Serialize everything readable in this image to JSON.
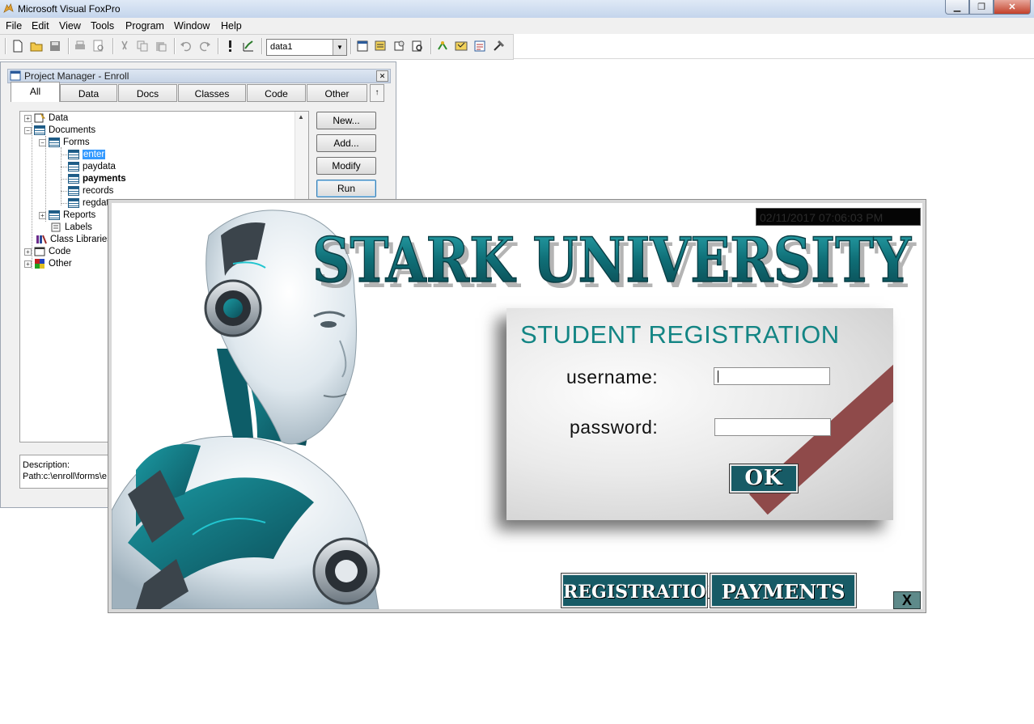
{
  "window": {
    "title": "Microsoft Visual FoxPro"
  },
  "menu": [
    "File",
    "Edit",
    "View",
    "Tools",
    "Program",
    "Window",
    "Help"
  ],
  "toolbar": {
    "database_combo_value": "data1"
  },
  "project_manager": {
    "title": "Project Manager - Enroll",
    "tabs": [
      "All",
      "Data",
      "Docs",
      "Classes",
      "Code",
      "Other"
    ],
    "active_tab": "All",
    "up_arrow": "↑",
    "tree": {
      "data": "Data",
      "documents": "Documents",
      "forms": "Forms",
      "form_items": [
        "enter",
        "paydata",
        "payments",
        "records",
        "regdat"
      ],
      "reports": "Reports",
      "labels": "Labels",
      "class_libraries": "Class Libraries",
      "code": "Code",
      "other": "Other"
    },
    "buttons": {
      "new": "New...",
      "add": "Add...",
      "modify": "Modify",
      "run": "Run"
    },
    "description_label": "Description:",
    "path": "Path:c:\\enroll\\forms\\e"
  },
  "form": {
    "datetime": "02/11/2017 07:06:03 PM",
    "university_title": "STARK UNIVERSITY",
    "login": {
      "title": "STUDENT REGISTRATION",
      "username_label": "username:",
      "username_value": "",
      "password_label": "password:",
      "password_value": "",
      "ok_label": "OK"
    },
    "registration_button": "REGISTRATION",
    "payments_button": "PAYMENTS",
    "close_label": "X"
  },
  "colors": {
    "teal_brand": "#138584",
    "button_teal": "#175b66",
    "stripe": "#8f4a4a",
    "selection": "#3399ff"
  }
}
